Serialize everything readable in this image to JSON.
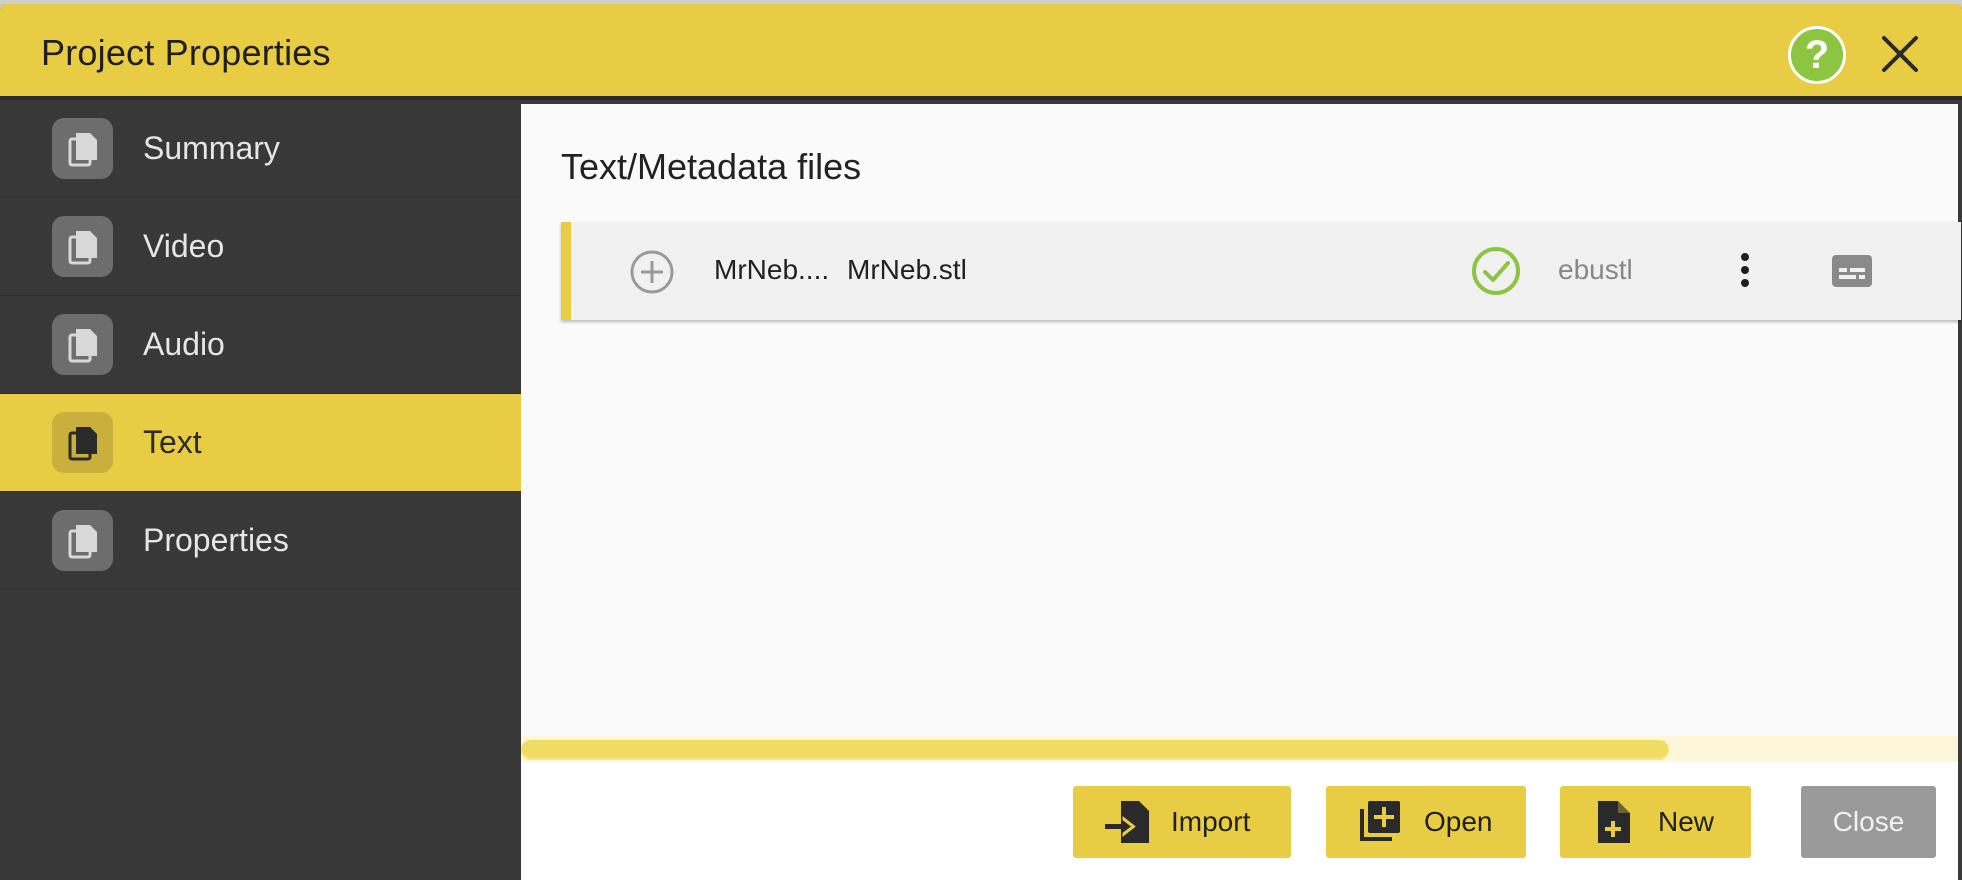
{
  "dialog": {
    "title": "Project Properties",
    "help_icon": "question-icon",
    "close_icon": "close-icon"
  },
  "sidebar": {
    "items": [
      {
        "label": "Summary",
        "icon": "copy-icon",
        "active": false
      },
      {
        "label": "Video",
        "icon": "copy-icon",
        "active": false
      },
      {
        "label": "Audio",
        "icon": "copy-icon",
        "active": false
      },
      {
        "label": "Text",
        "icon": "copy-icon",
        "active": true
      },
      {
        "label": "Properties",
        "icon": "copy-icon",
        "active": false
      }
    ]
  },
  "main": {
    "title": "Text/Metadata files",
    "files": [
      {
        "name_short": "MrNeb....",
        "name_full": "MrNeb.stl",
        "status_icon": "check-circle-icon",
        "format": "ebustl"
      }
    ]
  },
  "footer": {
    "import_label": "Import",
    "open_label": "Open",
    "new_label": "New",
    "close_label": "Close"
  },
  "colors": {
    "accent": "#e8cc44",
    "sidebar_bg": "#393838",
    "success": "#8cc540",
    "close_button": "#9a9a9a"
  }
}
